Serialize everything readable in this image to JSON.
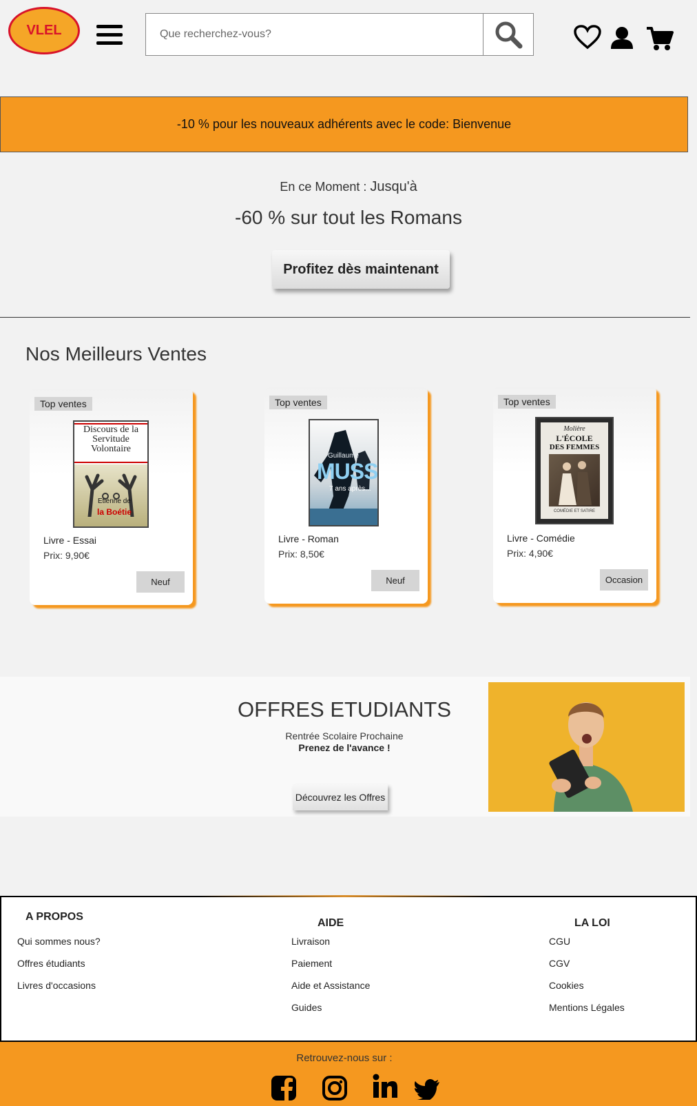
{
  "header": {
    "logo_text": "VLEL",
    "search_placeholder": "Que recherchez-vous?"
  },
  "promo": {
    "text": "-10 % pour les nouveaux adhérents avec le code: Bienvenue"
  },
  "moment": {
    "label": "En ce Moment : ",
    "label_big": "Jusqu'à",
    "headline": "-60 % sur tout les Romans",
    "cta": "Profitez dès maintenant"
  },
  "bestsellers": {
    "title": "Nos Meilleurs Ventes",
    "items": [
      {
        "badge": "Top ventes",
        "type": "Livre - Essai",
        "price": "Prix: 9,90€",
        "condition": "Neuf",
        "cover_title": "Discours de la Servitude Volontaire",
        "cover_author_1": "Etienne de",
        "cover_author_2": "la Boétie"
      },
      {
        "badge": "Top ventes",
        "type": "Livre - Roman",
        "price": "Prix: 8,50€",
        "condition": "Neuf",
        "cover_author": "Guillaume",
        "cover_name": "MUSSO",
        "cover_title": "7 ans après..."
      },
      {
        "badge": "Top ventes",
        "type": "Livre - Comédie",
        "price": "Prix: 4,90€",
        "condition": "Occasion",
        "cover_author": "Molière",
        "cover_title_1": "L'ÉCOLE",
        "cover_title_2": "DES FEMMES",
        "cover_sub": "COMÉDIE ET SATIRE"
      }
    ]
  },
  "students": {
    "title": "OFFRES ETUDIANTS",
    "subtitle": "Rentrée Scolaire Prochaine",
    "subtitle_bold": "Prenez de l'avance !",
    "button": "Découvrez les Offres"
  },
  "footer": {
    "columns": [
      {
        "heading": "A PROPOS",
        "links": [
          "Qui sommes nous?",
          "Offres étudiants",
          "Livres d'occasions"
        ]
      },
      {
        "heading": "AIDE",
        "links": [
          "Livraison",
          "Paiement",
          "Aide et Assistance",
          "Guides"
        ]
      },
      {
        "heading": "LA LOI",
        "links": [
          "CGU",
          "CGV",
          "Cookies",
          "Mentions Légales"
        ]
      }
    ],
    "social_label": "Retrouvez-nous sur :",
    "social_icons": [
      "facebook-icon",
      "instagram-icon",
      "linkedin-icon",
      "twitter-icon"
    ]
  },
  "colors": {
    "accent": "#f5981f",
    "logo_red": "#d8122a"
  }
}
